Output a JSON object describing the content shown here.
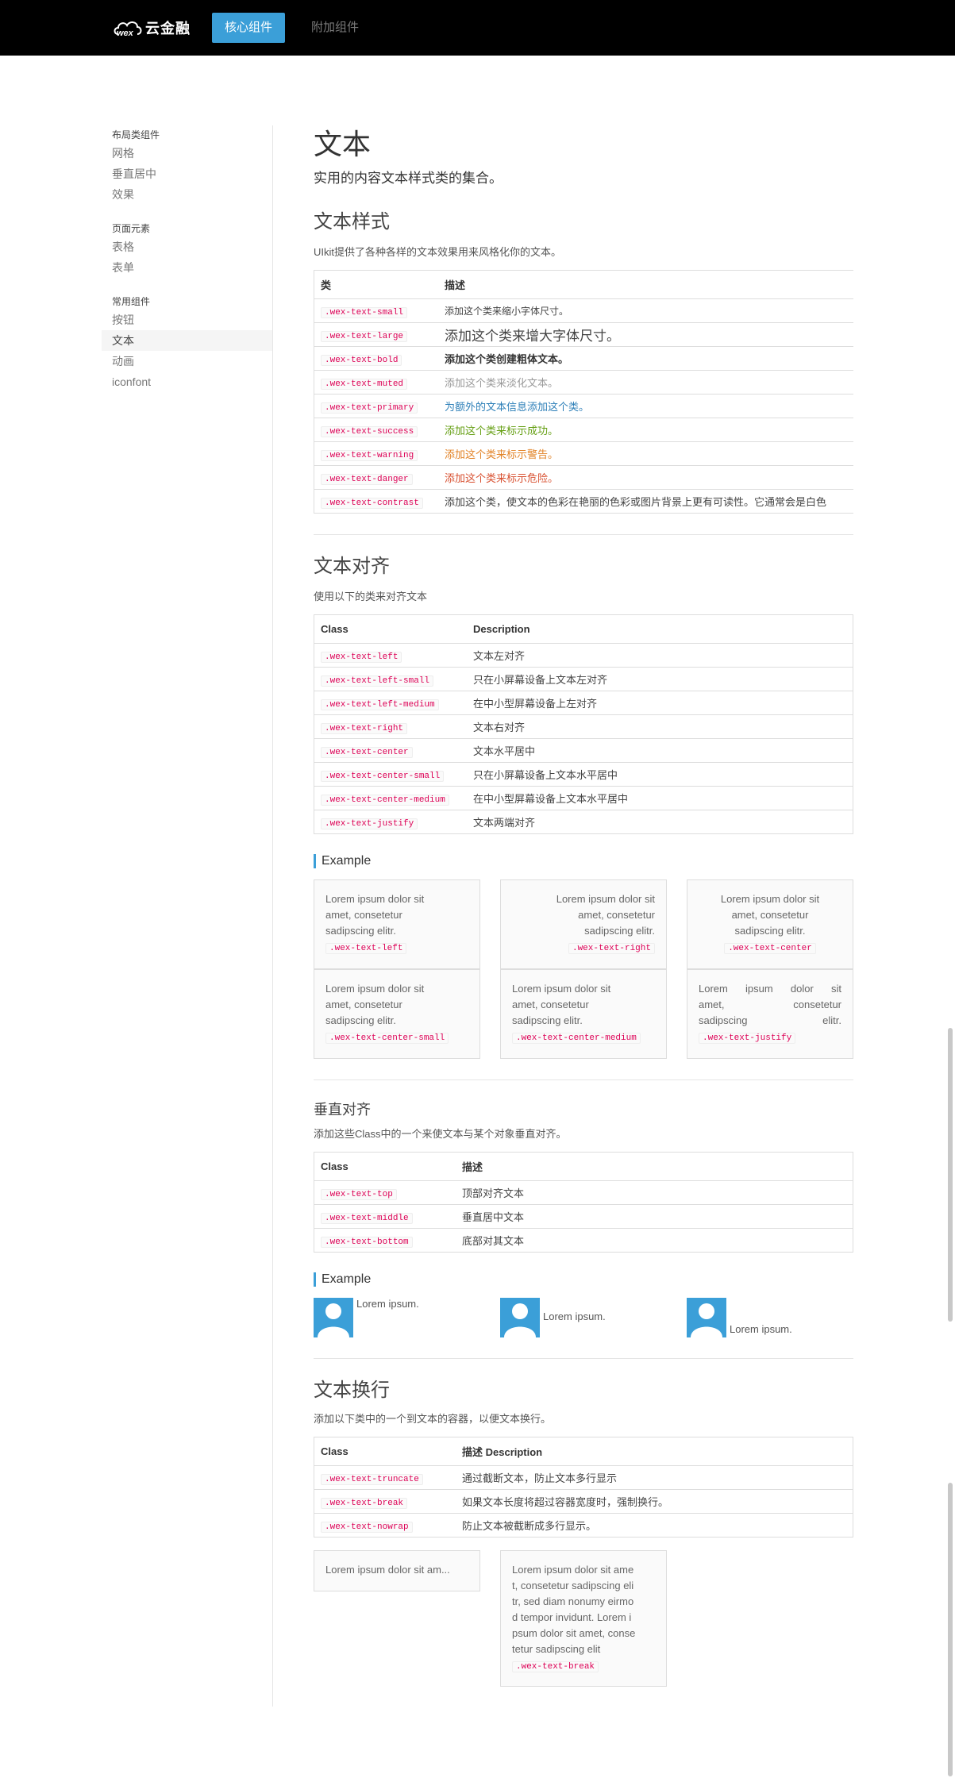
{
  "brand": {
    "logo_mark": "wex",
    "logo_name": "云金融"
  },
  "topnav": {
    "core": "核心组件",
    "extra": "附加组件"
  },
  "sidebar": {
    "groups": [
      {
        "title": "布局类组件",
        "items": [
          "网格",
          "垂直居中",
          "效果"
        ]
      },
      {
        "title": "页面元素",
        "items": [
          "表格",
          "表单"
        ]
      },
      {
        "title": "常用组件",
        "items": [
          "按钮",
          "文本",
          "动画",
          "iconfont"
        ]
      }
    ]
  },
  "page": {
    "title": "文本",
    "lead": "实用的内容文本样式类的集合。"
  },
  "style_section": {
    "heading": "文本样式",
    "desc": "UIkit提供了各种各样的文本效果用来风格化你的文本。",
    "col_class": "类",
    "col_desc": "描述",
    "rows": [
      {
        "cls": ".wex-text-small",
        "desc": "添加这个类来缩小字体尺寸。"
      },
      {
        "cls": ".wex-text-large",
        "desc": "添加这个类来增大字体尺寸。"
      },
      {
        "cls": ".wex-text-bold",
        "desc": "添加这个类创建粗体文本。"
      },
      {
        "cls": ".wex-text-muted",
        "desc": "添加这个类来淡化文本。"
      },
      {
        "cls": ".wex-text-primary",
        "desc": "为额外的文本信息添加这个类。"
      },
      {
        "cls": ".wex-text-success",
        "desc": "添加这个类来标示成功。"
      },
      {
        "cls": ".wex-text-warning",
        "desc": "添加这个类来标示警告。"
      },
      {
        "cls": ".wex-text-danger",
        "desc": "添加这个类来标示危险。"
      },
      {
        "cls": ".wex-text-contrast",
        "desc": "添加这个类，使文本的色彩在艳丽的色彩或图片背景上更有可读性。它通常会是白色"
      }
    ],
    "colors": {
      "muted": "#999999",
      "primary": "#2d7fb8",
      "success": "#659f13",
      "warning": "#e28327",
      "danger": "#d85030"
    }
  },
  "align_section": {
    "heading": "文本对齐",
    "desc": "使用以下的类来对齐文本",
    "col_class": "Class",
    "col_desc": "Description",
    "rows": [
      {
        "cls": ".wex-text-left",
        "desc": "文本左对齐"
      },
      {
        "cls": ".wex-text-left-small",
        "desc": "只在小屏幕设备上文本左对齐"
      },
      {
        "cls": ".wex-text-left-medium",
        "desc": "在中小型屏幕设备上左对齐"
      },
      {
        "cls": ".wex-text-right",
        "desc": "文本右对齐"
      },
      {
        "cls": ".wex-text-center",
        "desc": "文本水平居中"
      },
      {
        "cls": ".wex-text-center-small",
        "desc": "只在小屏幕设备上文本水平居中"
      },
      {
        "cls": ".wex-text-center-medium",
        "desc": "在中小型屏幕设备上文本水平居中"
      },
      {
        "cls": ".wex-text-justify",
        "desc": "文本两端对齐"
      }
    ],
    "example_title": "Example",
    "lorem": "Lorem ipsum dolor sit amet, consetetur sadipscing elitr.",
    "lorem_lines": [
      "Lorem ipsum dolor sit",
      "amet, consetetur",
      "sadipscing elitr."
    ],
    "justify_lines": [
      [
        "Lorem",
        "ipsum",
        "dolor",
        "sit"
      ],
      [
        "amet,",
        "consetetur"
      ],
      [
        "sadipscing",
        "elitr."
      ]
    ],
    "examples": [
      ".wex-text-left",
      ".wex-text-right",
      ".wex-text-center",
      ".wex-text-center-small",
      ".wex-text-center-medium",
      ".wex-text-justify"
    ]
  },
  "valign_section": {
    "heading": "垂直对齐",
    "desc": "添加这些Class中的一个来使文本与某个对象垂直对齐。",
    "col_class": "Class",
    "col_desc": "描述",
    "rows": [
      {
        "cls": ".wex-text-top",
        "desc": "顶部对齐文本"
      },
      {
        "cls": ".wex-text-middle",
        "desc": "垂直居中文本"
      },
      {
        "cls": ".wex-text-bottom",
        "desc": "底部对其文本"
      }
    ],
    "example_title": "Example",
    "sample": "Lorem ipsum."
  },
  "wrap_section": {
    "heading": "文本换行",
    "desc": "添加以下类中的一个到文本的容器，以便文本换行。",
    "col_class": "Class",
    "col_desc": "描述 Description",
    "rows": [
      {
        "cls": ".wex-text-truncate",
        "desc": "通过截断文本，防止文本多行显示"
      },
      {
        "cls": ".wex-text-break",
        "desc": "如果文本长度将超过容器宽度时，强制换行。"
      },
      {
        "cls": ".wex-text-nowrap",
        "desc": "防止文本被截断成多行显示。"
      }
    ],
    "truncate_text": "Lorem ipsum dolor sit am...",
    "break_lines": [
      "Lorem ipsum dolor sit ame",
      "t, consetetur sadipscing eli",
      "tr, sed diam nonumy eirmo",
      "d tempor invidunt. Lorem i",
      "psum dolor sit amet, conse",
      "tetur sadipscing elit"
    ],
    "break_class": ".wex-text-break"
  }
}
